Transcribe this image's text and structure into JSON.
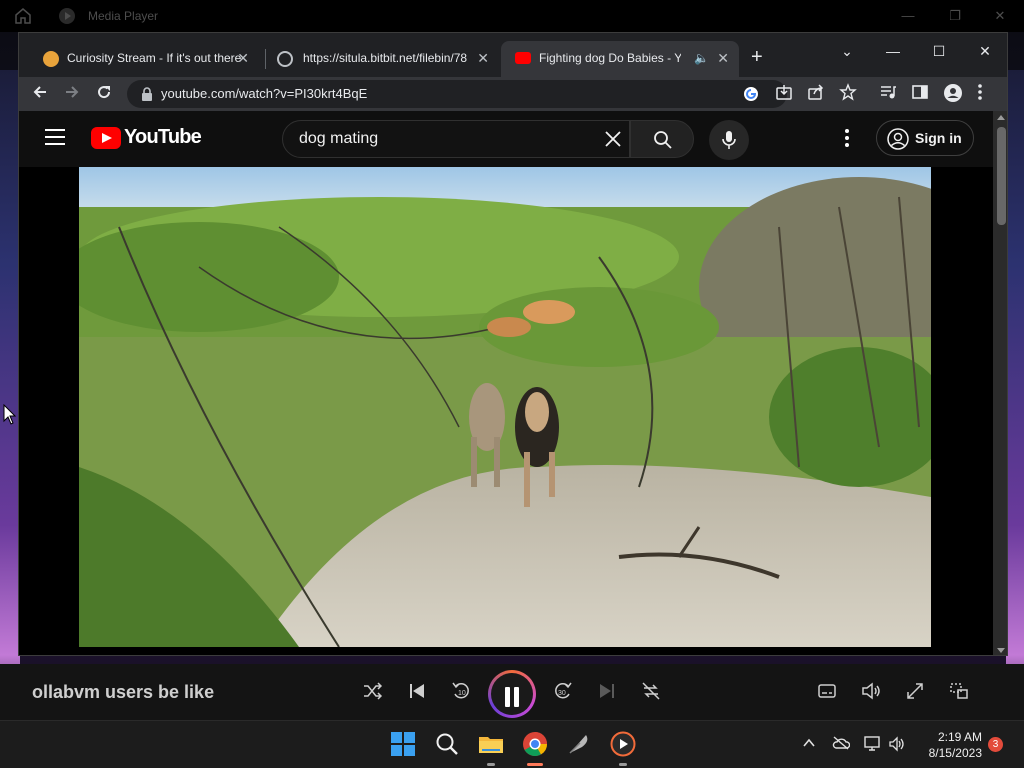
{
  "media_player": {
    "title": "Media Player",
    "track_title": "ollabvm users be like",
    "controls": [
      "shuffle",
      "previous",
      "rewind-10",
      "pause",
      "forward-30",
      "next",
      "repeat"
    ],
    "forward_label": "30",
    "rewind_label": "10"
  },
  "browser": {
    "tabs": [
      {
        "title": "Curiosity Stream - If it's out there",
        "active": false
      },
      {
        "title": "https://situla.bitbit.net/filebin/78",
        "active": false
      },
      {
        "title": "Fighting dog Do Babies - YouTube",
        "active": true,
        "audio": true
      }
    ],
    "url": "youtube.com/watch?v=PI30krt4BqE"
  },
  "youtube": {
    "logo_text": "YouTube",
    "search_query": "dog mating",
    "sign_in_label": "Sign in"
  },
  "taskbar": {
    "time": "2:19 AM",
    "date": "8/15/2023",
    "notification_count": "3"
  },
  "colors": {
    "youtube_red": "#ff0000",
    "chrome_dark": "#202124",
    "toolbar": "#35363a",
    "accent_orange": "#f26b3a",
    "accent_purple": "#c94bd6"
  }
}
